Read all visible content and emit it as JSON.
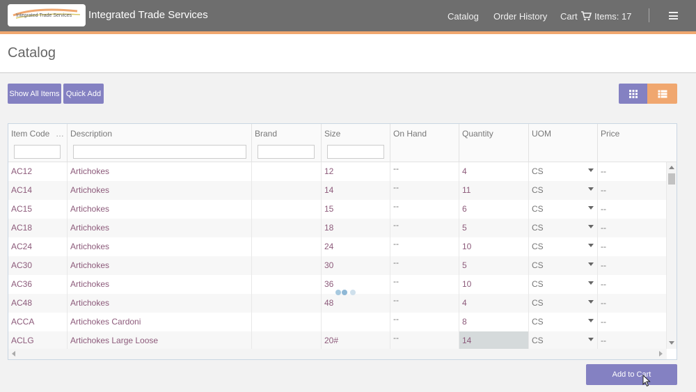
{
  "header": {
    "logo_text": "Integrated Trade Services",
    "app_title": "Integrated Trade Services",
    "nav": {
      "catalog": "Catalog",
      "order_history": "Order History",
      "cart": "Cart",
      "items": "Items: 17"
    },
    "colors": {
      "bar": "#6e6e6e",
      "accent": "#f0a76f"
    }
  },
  "page": {
    "title": "Catalog"
  },
  "toolbar": {
    "show_all": "Show All Items",
    "quick_add": "Quick Add",
    "grid_view_icon": "grid-icon",
    "list_view_icon": "list-icon",
    "active_view": "list"
  },
  "grid": {
    "columns": [
      "Item Code",
      "Description",
      "Brand",
      "Size",
      "On Hand",
      "Quantity",
      "UOM",
      "Price"
    ],
    "more_indicator": "…",
    "rows": [
      {
        "code": "AC12",
        "description": "Artichokes",
        "brand": "",
        "size": "12",
        "on_hand": "--",
        "quantity": "4",
        "uom": "CS",
        "price": "--"
      },
      {
        "code": "AC14",
        "description": "Artichokes",
        "brand": "",
        "size": "14",
        "on_hand": "--",
        "quantity": "11",
        "uom": "CS",
        "price": "--"
      },
      {
        "code": "AC15",
        "description": "Artichokes",
        "brand": "",
        "size": "15",
        "on_hand": "--",
        "quantity": "6",
        "uom": "CS",
        "price": "--"
      },
      {
        "code": "AC18",
        "description": "Artichokes",
        "brand": "",
        "size": "18",
        "on_hand": "--",
        "quantity": "5",
        "uom": "CS",
        "price": "--"
      },
      {
        "code": "AC24",
        "description": "Artichokes",
        "brand": "",
        "size": "24",
        "on_hand": "--",
        "quantity": "10",
        "uom": "CS",
        "price": "--"
      },
      {
        "code": "AC30",
        "description": "Artichokes",
        "brand": "",
        "size": "30",
        "on_hand": "--",
        "quantity": "5",
        "uom": "CS",
        "price": "--"
      },
      {
        "code": "AC36",
        "description": "Artichokes",
        "brand": "",
        "size": "36",
        "on_hand": "--",
        "quantity": "10",
        "uom": "CS",
        "price": "--"
      },
      {
        "code": "AC48",
        "description": "Artichokes",
        "brand": "",
        "size": "48",
        "on_hand": "--",
        "quantity": "4",
        "uom": "CS",
        "price": "--"
      },
      {
        "code": "ACCA",
        "description": "Artichokes Cardoni",
        "brand": "",
        "size": "",
        "on_hand": "--",
        "quantity": "8",
        "uom": "CS",
        "price": "--"
      },
      {
        "code": "ACLG",
        "description": "Artichokes Large Loose",
        "brand": "",
        "size": "20#",
        "on_hand": "--",
        "quantity": "14",
        "uom": "CS",
        "price": "--"
      }
    ]
  },
  "footer": {
    "add_to_cart": "Add to Cart"
  }
}
